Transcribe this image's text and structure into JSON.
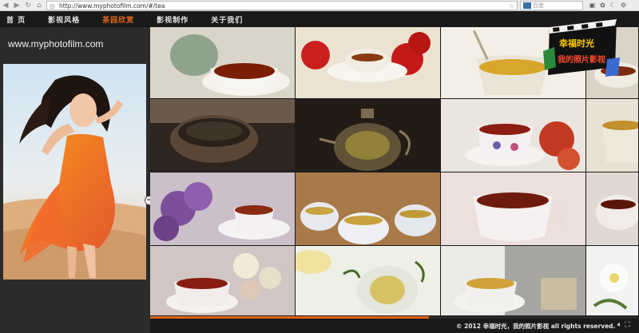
{
  "browser": {
    "url": "http://www.myphotofilm.com/#/tea",
    "search_placeholder": "百度"
  },
  "nav": {
    "items": [
      {
        "label": "首  页"
      },
      {
        "label": "影视风格"
      },
      {
        "label": "茶园欣赏"
      },
      {
        "label": "影视制作"
      },
      {
        "label": "关于我们"
      }
    ],
    "active_index": 2
  },
  "sidebar": {
    "domain": "www.myphotofilm.com"
  },
  "logo": {
    "text_line1": "幸福时光",
    "text_line2": "我的照片影视"
  },
  "progress": {
    "fraction": 0.57
  },
  "footer": {
    "text": "© 2012  幸福时光，我的照片影视  all rights reserved."
  },
  "colors": {
    "accent": "#e36a1a",
    "nav_bg": "#1a1a1a",
    "sidebar_bg": "#2b2b2b"
  }
}
